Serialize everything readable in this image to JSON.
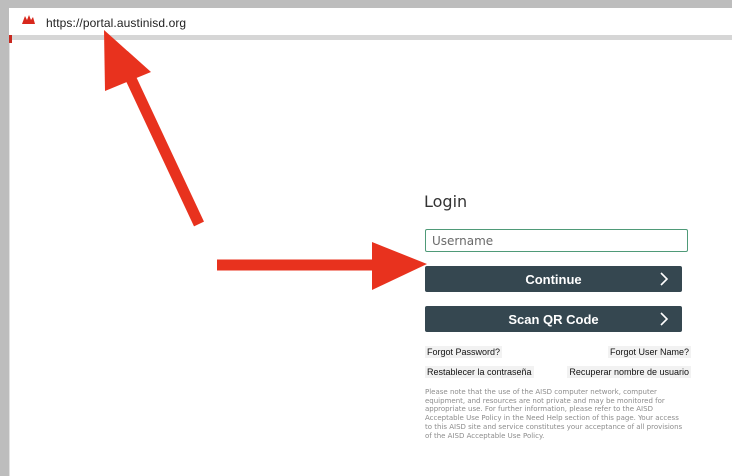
{
  "browser": {
    "url": "https://portal.austinisd.org"
  },
  "login": {
    "title": "Login",
    "username_placeholder": "Username",
    "continue_label": "Continue",
    "scan_qr_label": "Scan QR Code",
    "forgot_password": "Forgot Password?",
    "forgot_username": "Forgot User Name?",
    "reset_password_es": "Restablecer la contraseña",
    "recover_username_es": "Recuperar nombre de usuario",
    "disclaimer": "Please note that the use of the AISD computer network, computer equipment, and resources are not private and may be monitored for appropriate use. For further information, please refer to the AISD Acceptable Use Policy in the Need Help section of this page. Your access to this AISD site and service constitutes your acceptance of all provisions of the AISD Acceptable Use Policy."
  },
  "colors": {
    "button_bg": "#354750",
    "input_border": "#4f9a78",
    "annotation_arrow": "#e8321e"
  },
  "icons": {
    "favicon": "favicon-icon",
    "button_chevron": "chevron-right-icon",
    "annotation": "red-arrow-icon"
  }
}
